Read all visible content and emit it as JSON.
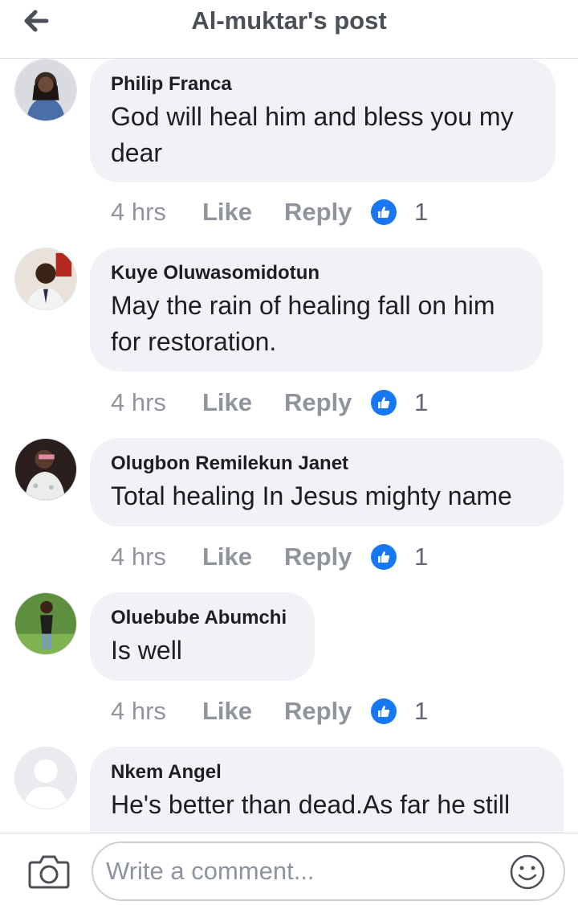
{
  "header": {
    "title": "Al-muktar's post",
    "back_icon": "back-arrow-icon"
  },
  "comments": [
    {
      "author": "Philip Franca",
      "text_lines": [
        "God will heal him and bless you my",
        "dear"
      ],
      "time": "4 hrs",
      "like_label": "Like",
      "reply_label": "Reply",
      "reaction_count": "1"
    },
    {
      "author": "Kuye Oluwasomidotun",
      "text_lines": [
        "May the rain of healing fall on him",
        "for restoration."
      ],
      "time": "4 hrs",
      "like_label": "Like",
      "reply_label": "Reply",
      "reaction_count": "1"
    },
    {
      "author": "Olugbon Remilekun Janet",
      "text_lines": [
        "Total healing In Jesus mighty name"
      ],
      "time": "4 hrs",
      "like_label": "Like",
      "reply_label": "Reply",
      "reaction_count": "1"
    },
    {
      "author": "Oluebube Abumchi",
      "text_lines": [
        "Is well"
      ],
      "time": "4 hrs",
      "like_label": "Like",
      "reply_label": "Reply",
      "reaction_count": "1"
    },
    {
      "author": "Nkem Angel",
      "text_lines": [
        "He's better than dead.As far he still"
      ]
    }
  ],
  "composer": {
    "placeholder": "Write a comment...",
    "camera_icon": "camera-icon",
    "emoji_icon": "emoji-icon"
  },
  "colors": {
    "reaction_blue": "#1877f2",
    "bubble_bg": "#f0f2f5",
    "muted_text": "#90949c"
  }
}
